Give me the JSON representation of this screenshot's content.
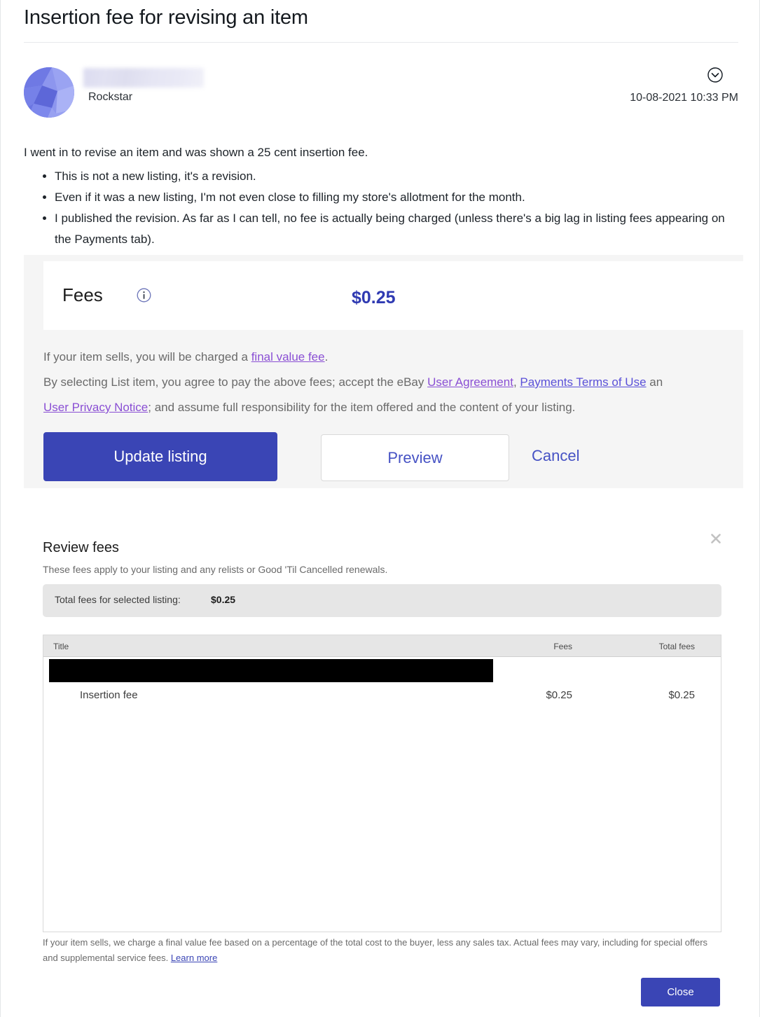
{
  "thread": {
    "title": "Insertion fee for revising an item"
  },
  "post": {
    "author_rank": "Rockstar",
    "date": "10-08-2021 10:33 PM",
    "collapse_icon": "chevron-down-circle-icon",
    "intro": "I went in to revise an item and was shown a 25 cent insertion fee.",
    "bullets": [
      "This is not a new listing, it's a revision.",
      "Even if it was a new listing, I'm not even close to filling my store's allotment for the month.",
      "I published the revision. As far as I can tell, no fee is actually being charged (unless there's a big lag in listing fees appearing on the Payments tab)."
    ]
  },
  "fee_panel": {
    "card": {
      "label": "Fees",
      "info_icon": "info-circle-icon",
      "amount": "$0.25"
    },
    "legal_line1_pre": "If your item sells, you will be charged a ",
    "legal_line1_link": "final value fee",
    "legal_line1_post": ".",
    "legal_line2_pre": "By selecting List item, you agree to pay the above fees; accept the eBay ",
    "legal_link_user_agreement": "User Agreement",
    "legal_line2_mid": ", ",
    "legal_link_payments_terms": "Payments Terms of Use",
    "legal_line2_post": " an",
    "legal_line3_link": "User Privacy Notice",
    "legal_line3_post": "; and assume full responsibility for the item offered and the content of your listing.",
    "buttons": {
      "update": "Update listing",
      "preview": "Preview",
      "cancel": "Cancel"
    }
  },
  "review_modal": {
    "title": "Review fees",
    "subtitle": "These fees apply to your listing and any relists or Good 'Til Cancelled renewals.",
    "close_icon": "close-x-icon",
    "total_label": "Total fees for selected listing:",
    "total_value": "$0.25",
    "table": {
      "columns": [
        "Title",
        "Fees",
        "Total fees"
      ],
      "redacted_row": true,
      "rows": [
        {
          "title": "Insertion fee",
          "fees": "$0.25",
          "total_fees": "$0.25"
        }
      ]
    },
    "footnote_text": "If your item sells, we charge a final value fee based on a percentage of the total cost to the buyer, less any sales tax. Actual fees may vary, including for special offers and supplemental service fees. ",
    "footnote_link": "Learn more",
    "close_button": "Close"
  },
  "colors": {
    "primary_blue": "#3a45b5",
    "link_purple": "#8a4fd4",
    "amount_blue": "#2f3ab2",
    "panel_gray": "#f5f5f5",
    "bar_gray": "#e6e6e6"
  }
}
